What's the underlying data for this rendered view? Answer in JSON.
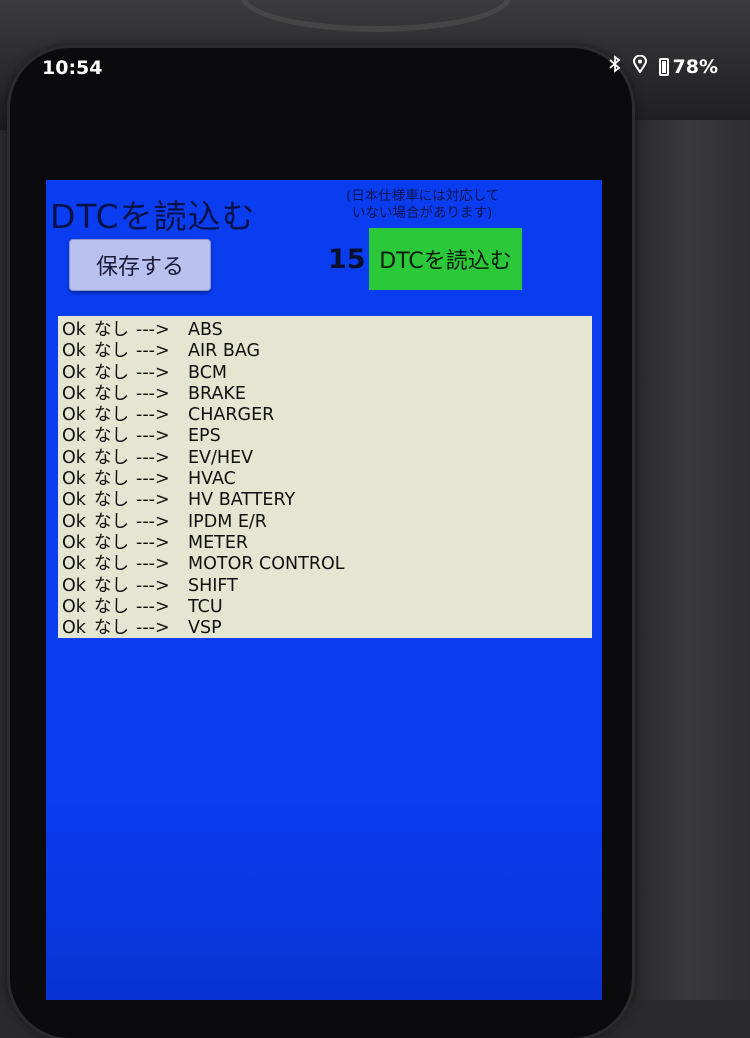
{
  "status_bar": {
    "time": "10:54",
    "battery": "78%",
    "icons": [
      "bluetooth-icon",
      "location-icon",
      "battery-icon"
    ]
  },
  "app": {
    "title": "DTCを読込む",
    "note_line1": "(日本仕様車には対応して",
    "note_line2": "いない場合があります)",
    "save_button": "保存する",
    "count": "15",
    "read_button": "DTCを読込む",
    "colors": {
      "background": "#0a3cf0",
      "read_button": "#2bc93a",
      "save_button": "#b9c1ee",
      "result_box": "#e4e6d2"
    },
    "results": [
      {
        "status": "Ok",
        "code": "なし",
        "arrow": "--->",
        "module": "ABS"
      },
      {
        "status": "Ok",
        "code": "なし",
        "arrow": "--->",
        "module": "AIR BAG"
      },
      {
        "status": "Ok",
        "code": "なし",
        "arrow": "--->",
        "module": "BCM"
      },
      {
        "status": "Ok",
        "code": "なし",
        "arrow": "--->",
        "module": "BRAKE"
      },
      {
        "status": "Ok",
        "code": "なし",
        "arrow": "--->",
        "module": "CHARGER"
      },
      {
        "status": "Ok",
        "code": "なし",
        "arrow": "--->",
        "module": "EPS"
      },
      {
        "status": "Ok",
        "code": "なし",
        "arrow": "--->",
        "module": "EV/HEV"
      },
      {
        "status": "Ok",
        "code": "なし",
        "arrow": "--->",
        "module": "HVAC"
      },
      {
        "status": "Ok",
        "code": "なし",
        "arrow": "--->",
        "module": "HV BATTERY"
      },
      {
        "status": "Ok",
        "code": "なし",
        "arrow": "--->",
        "module": "IPDM E/R"
      },
      {
        "status": "Ok",
        "code": "なし",
        "arrow": "--->",
        "module": "METER"
      },
      {
        "status": "Ok",
        "code": "なし",
        "arrow": "--->",
        "module": "MOTOR CONTROL"
      },
      {
        "status": "Ok",
        "code": "なし",
        "arrow": "--->",
        "module": "SHIFT"
      },
      {
        "status": "Ok",
        "code": "なし",
        "arrow": "--->",
        "module": "TCU"
      },
      {
        "status": "Ok",
        "code": "なし",
        "arrow": "--->",
        "module": "VSP"
      }
    ]
  }
}
